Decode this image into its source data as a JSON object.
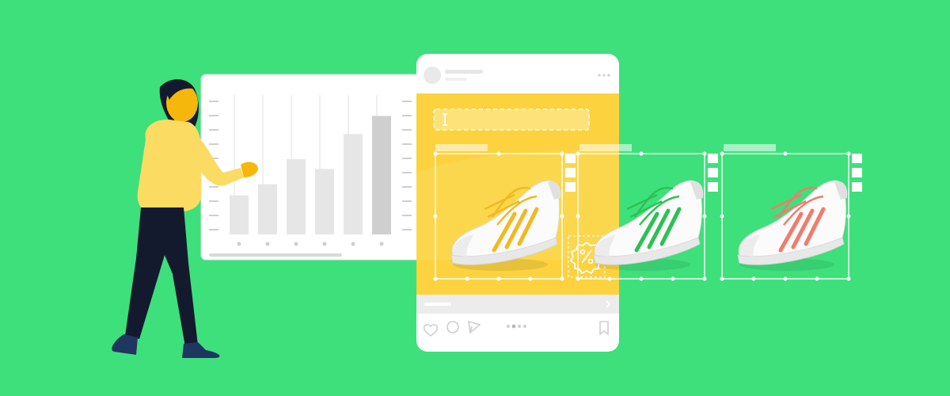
{
  "colors": {
    "background": "#3ee07c",
    "panel": "#ffffff",
    "bar_light": "#e6e6e6",
    "bar_dark": "#cfcfcf",
    "post_yellow": "#fcd23f",
    "person_shirt": "#fcdb63",
    "person_skin": "#f5b70b",
    "person_pants": "#141a2e",
    "lace_yellow": "#f2b91f",
    "lace_green": "#2cc154",
    "lace_red": "#f27b6b"
  },
  "chart_data": {
    "type": "bar",
    "categories": [
      "",
      "",
      "",
      "",
      "",
      ""
    ],
    "values": [
      28,
      36,
      54,
      47,
      72,
      85
    ],
    "title": "",
    "xlabel": "",
    "ylabel": "",
    "ylim": [
      0,
      100
    ],
    "grid": false
  },
  "icons": {
    "like": "heart-icon",
    "comment": "comment-icon",
    "share": "send-icon",
    "save": "bookmark-icon",
    "discount": "discount-badge-icon",
    "text_cursor": "text-cursor-icon",
    "next": "chevron-right-icon"
  },
  "post": {
    "carousel_dots": 4
  },
  "products": [
    {
      "color": "yellow"
    },
    {
      "color": "green"
    },
    {
      "color": "red"
    }
  ]
}
